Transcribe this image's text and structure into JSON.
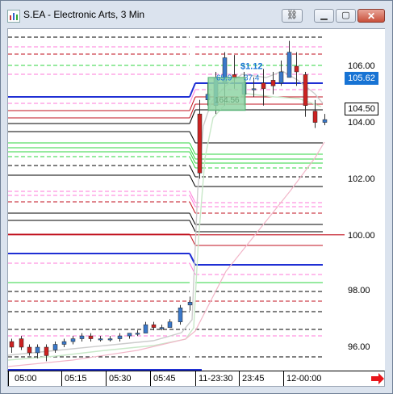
{
  "window": {
    "title": "S.EA - Electronic Arts, 3 Min",
    "buttons": {
      "link": "link-icon",
      "minimize": "minimize-icon",
      "maximize": "maximize-icon",
      "close": "close-icon"
    }
  },
  "colors": {
    "up": "#3a78c9",
    "down": "#cc2222",
    "blue_level": "#1f2fd4",
    "red_level": "#c1121f",
    "green_level": "#2fd640",
    "pink_level": "#ff7ad9",
    "black_level": "#000000",
    "current_price_bg": "#1773d4",
    "last_price_bg": "#ffffff"
  },
  "y_axis": {
    "ticks": [
      "106.00",
      "104.00",
      "102.00",
      "100.00",
      "98.00",
      "96.00"
    ],
    "current_price_label": "105.62",
    "last_price_label": "104.50"
  },
  "x_axis": {
    "labels": [
      "05:00",
      "05:15",
      "05:30",
      "05:45",
      "11-23:30",
      "23:45",
      "12-00:00"
    ]
  },
  "annotations": {
    "gain_label": "$1.12",
    "overlay_text_1": "65.9",
    "overlay_text_2": "37.4",
    "overlay_text_3": "164.56"
  }
}
